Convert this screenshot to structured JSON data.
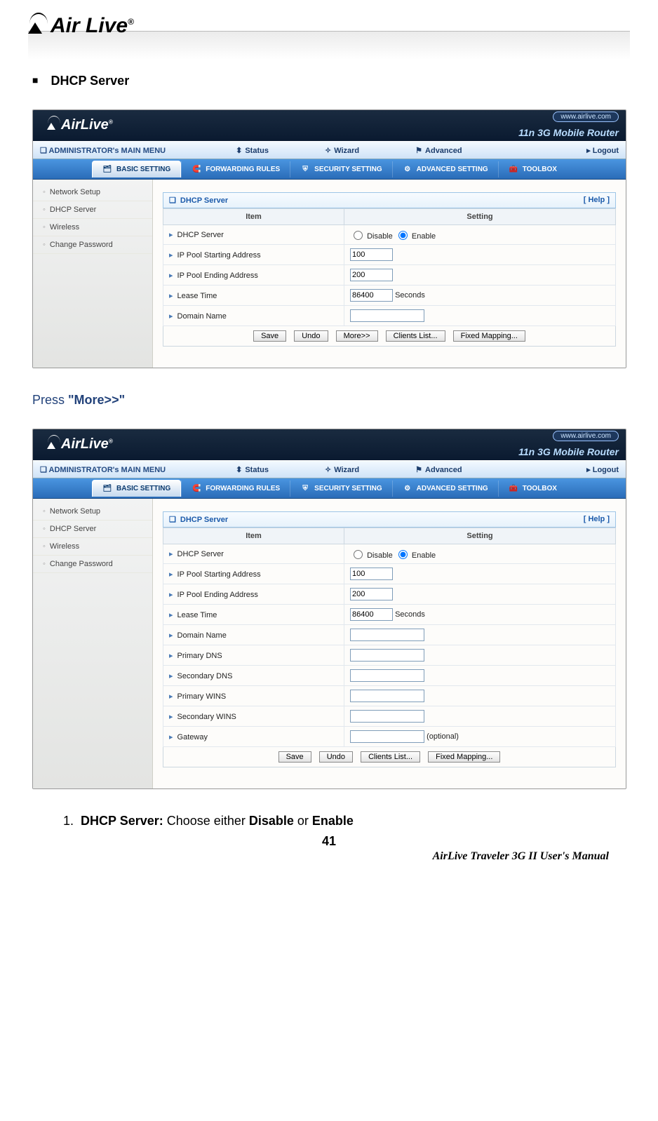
{
  "logo": {
    "brand": "Air Live",
    "reg": "®"
  },
  "section_title": "DHCP Server",
  "screenshot": {
    "brand": "AirLive",
    "reg": "®",
    "url": "www.airlive.com",
    "router": "11n 3G Mobile Router",
    "mainmenu": {
      "title": "ADMINISTRATOR's MAIN MENU",
      "status": "Status",
      "wizard": "Wizard",
      "advanced": "Advanced",
      "logout": "Logout"
    },
    "tabs": {
      "basic": "BASIC SETTING",
      "forwarding": "FORWARDING RULES",
      "security": "SECURITY SETTING",
      "advanced": "ADVANCED SETTING",
      "toolbox": "TOOLBOX"
    },
    "sidebar": [
      "Network Setup",
      "DHCP Server",
      "Wireless",
      "Change Password"
    ],
    "panel": {
      "title": "DHCP Server",
      "help": "[ Help ]",
      "th_item": "Item",
      "th_setting": "Setting"
    },
    "rows_basic": {
      "dhcp_server": "DHCP Server",
      "disable": "Disable",
      "enable": "Enable",
      "ip_start": "IP Pool Starting Address",
      "ip_start_val": "100",
      "ip_end": "IP Pool Ending Address",
      "ip_end_val": "200",
      "lease_time": "Lease Time",
      "lease_time_val": "86400",
      "seconds": "Seconds",
      "domain_name": "Domain Name",
      "domain_name_val": ""
    },
    "rows_more": {
      "primary_dns": "Primary DNS",
      "secondary_dns": "Secondary DNS",
      "primary_wins": "Primary WINS",
      "secondary_wins": "Secondary WINS",
      "gateway": "Gateway",
      "optional": "(optional)"
    },
    "buttons": {
      "save": "Save",
      "undo": "Undo",
      "more": "More>>",
      "clients": "Clients List...",
      "fixed": "Fixed Mapping..."
    }
  },
  "body_text": {
    "press": "Press ",
    "more": "\"More>>\""
  },
  "list1": {
    "num": "1.",
    "b1": "DHCP Server:",
    "t1": " Choose either ",
    "b2": "Disable",
    "t2": " or ",
    "b3": "Enable"
  },
  "page_number": "41",
  "footer": "AirLive Traveler 3G II User's Manual"
}
